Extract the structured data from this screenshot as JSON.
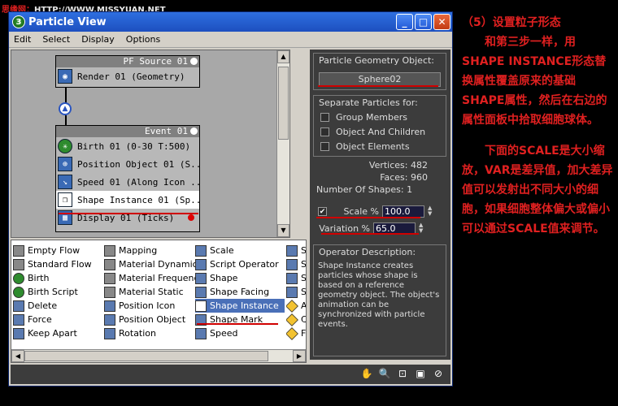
{
  "watermark": {
    "site": "思缘网：",
    "url": "HTTP://WWW.MISSYUAN.NET"
  },
  "window": {
    "title": "Particle View",
    "app_glyph": "3",
    "minimize": "_",
    "maximize": "□",
    "close": "✕"
  },
  "menu": [
    "Edit",
    "Select",
    "Display",
    "Options"
  ],
  "graph": {
    "source_node": {
      "title": "PF Source 01",
      "rows": [
        "Render 01 (Geometry)"
      ]
    },
    "event_node": {
      "title": "Event 01",
      "rows": [
        "Birth 01 (0-30 T:500)",
        "Position Object 01 (S...",
        "Speed 01 (Along Icon ...",
        "Shape Instance 01 (Sp...",
        "Display 01 (Ticks)"
      ]
    }
  },
  "right_panel": {
    "geometry_group_title": "Particle Geometry Object:",
    "geometry_object": "Sphere02",
    "separate_title": "Separate Particles for:",
    "checks": [
      "Group Members",
      "Object And Children",
      "Object Elements"
    ],
    "vertices_label": "Vertices:",
    "vertices": "482",
    "faces_label": "Faces:",
    "faces": "960",
    "shapes_label": "Number Of Shapes:",
    "shapes": "1",
    "scale_label": "Scale %",
    "scale_value": "100.0",
    "variation_label": "Variation %",
    "variation_value": "65.0",
    "desc_title": "Operator Description:",
    "desc_text": "Shape Instance creates particles whose shape is based on a reference geometry object. The object's animation can be synchronized with particle events."
  },
  "palette": {
    "col1": [
      "Empty Flow",
      "Standard Flow",
      "Birth",
      "Birth Script",
      "Delete",
      "Force",
      "Keep Apart"
    ],
    "col2": [
      "Mapping",
      "Material Dynamic",
      "Material Frequency",
      "Material Static",
      "Position Icon",
      "Position Object",
      "Rotation"
    ],
    "col3": [
      "Scale",
      "Script Operator",
      "Shape",
      "Shape Facing",
      "Shape Instance",
      "Shape Mark",
      "Speed"
    ],
    "col4": [
      "S",
      "S",
      "S",
      "S",
      "A",
      "C",
      "F"
    ]
  },
  "notes": [
    "（5）设置粒子形态",
    "　　和第三步一样，用SHAPE INSTANCE形态替换属性覆盖原来的基础SHAPE属性，然后在右边的属性面板中拾取细胞球体。",
    "　　下面的SCALE是大小缩放，VAR是差异值，加大差异值可以发射出不同大小的细胞，如果细胞整体偏大或偏小可以通过SCALE值来调节。"
  ]
}
